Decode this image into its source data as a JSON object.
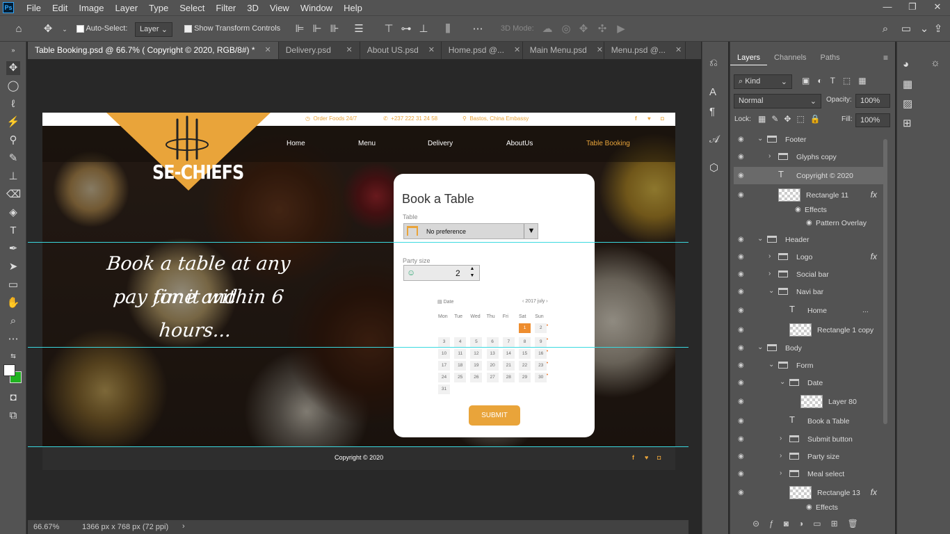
{
  "app": {
    "logo": "Ps",
    "menu": [
      "File",
      "Edit",
      "Image",
      "Layer",
      "Type",
      "Select",
      "Filter",
      "3D",
      "View",
      "Window",
      "Help"
    ],
    "window_controls": [
      "—",
      "❐",
      "✕"
    ]
  },
  "options": {
    "auto_select_label": "Auto-Select:",
    "auto_select_value": "Layer",
    "show_transform_label": "Show Transform Controls",
    "mode_3d": "3D Mode:"
  },
  "tabs": [
    {
      "label": "Table Booking.psd @ 66.7% ( Copyright © 2020, RGB/8#) *",
      "active": true
    },
    {
      "label": "Delivery.psd"
    },
    {
      "label": "About US.psd"
    },
    {
      "label": "Home.psd @..."
    },
    {
      "label": "Main Menu.psd"
    },
    {
      "label": "Menu.psd @..."
    }
  ],
  "site": {
    "topbar": {
      "order": "Order Foods 24/7",
      "phone": "+237 222 31 24 58",
      "address": "Bastos, China Embassy"
    },
    "logo": "SE-CHIEFS",
    "nav": [
      "Home",
      "Menu",
      "Delivery",
      "AboutUs",
      "Table Booking"
    ],
    "tagline": [
      "Book a table at any time and",
      "pay for it within 6 hours..."
    ],
    "form": {
      "title": "Book a Table",
      "table_label": "Table",
      "table_value": "No preference",
      "party_label": "Party size",
      "party_value": "2",
      "date_label": "Date",
      "month": "2017 july",
      "weekdays": [
        "Mon",
        "Tue",
        "Wed",
        "Thu",
        "Fri",
        "Sat",
        "Sun"
      ],
      "days": [
        [
          "",
          "",
          "",
          "",
          "1",
          "2"
        ],
        [
          "3",
          "4",
          "5",
          "6",
          "7",
          "8",
          "9"
        ],
        [
          "10",
          "11",
          "12",
          "13",
          "14",
          "15",
          "16"
        ],
        [
          "17",
          "18",
          "19",
          "20",
          "21",
          "22",
          "23"
        ],
        [
          "24",
          "25",
          "26",
          "27",
          "28",
          "29",
          "30"
        ],
        [
          "31"
        ]
      ],
      "submit": "SUBMIT"
    },
    "footer": "Copyright © 2020"
  },
  "status": {
    "zoom": "66.67%",
    "doc_info": "1366 px x 768 px (72 ppi)"
  },
  "layers_panel": {
    "tabs": [
      "Layers",
      "Channels",
      "Paths"
    ],
    "kind": "Kind",
    "blend": "Normal",
    "opacity_label": "Opacity:",
    "opacity": "100%",
    "lock_label": "Lock:",
    "fill_label": "Fill:",
    "fill": "100%",
    "rows": [
      {
        "name": "Footer",
        "type": "folder",
        "indent": 0,
        "open": true
      },
      {
        "name": "Glyphs copy",
        "type": "folder",
        "indent": 1
      },
      {
        "name": "Copyright © 2020",
        "type": "text",
        "indent": 1,
        "selected": true
      },
      {
        "name": "Rectangle 11",
        "type": "shape",
        "indent": 1,
        "fx": true
      },
      {
        "name": "Effects",
        "type": "effect",
        "indent": 2
      },
      {
        "name": "Pattern Overlay",
        "type": "effect",
        "indent": 3
      },
      {
        "name": "Header",
        "type": "folder",
        "indent": 0,
        "open": true
      },
      {
        "name": "Logo",
        "type": "folder",
        "indent": 1,
        "fx": true
      },
      {
        "name": "Social bar",
        "type": "folder",
        "indent": 1
      },
      {
        "name": "Navi bar",
        "type": "folder",
        "indent": 1,
        "open": true
      },
      {
        "name": "Home",
        "type": "text",
        "indent": 2,
        "more": "..."
      },
      {
        "name": "Rectangle 1 copy",
        "type": "shape",
        "indent": 2
      },
      {
        "name": "Body",
        "type": "folder",
        "indent": 0,
        "open": true
      },
      {
        "name": "Form",
        "type": "folder",
        "indent": 1,
        "open": true
      },
      {
        "name": "Date",
        "type": "folder",
        "indent": 2,
        "open": true
      },
      {
        "name": "Layer 80",
        "type": "pixel",
        "indent": 3
      },
      {
        "name": "Book a Table",
        "type": "text",
        "indent": 2
      },
      {
        "name": "Submit button",
        "type": "folder",
        "indent": 2
      },
      {
        "name": "Party size",
        "type": "folder",
        "indent": 2
      },
      {
        "name": "Meal select",
        "type": "folder",
        "indent": 2
      },
      {
        "name": "Rectangle 13",
        "type": "shape",
        "indent": 2,
        "fx": true
      },
      {
        "name": "Effects",
        "type": "effect",
        "indent": 3
      }
    ]
  },
  "colors": {
    "accent": "#e9a43a",
    "chrome": "#535353",
    "guide": "#3ad9e0"
  }
}
